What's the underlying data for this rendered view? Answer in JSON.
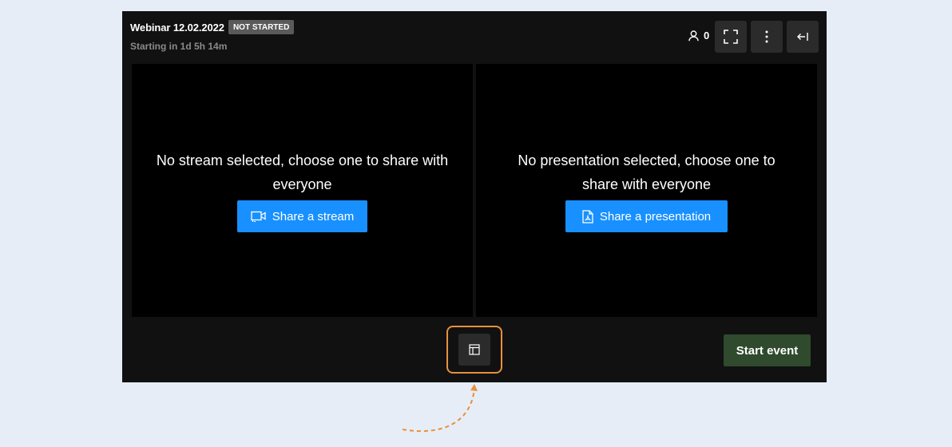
{
  "header": {
    "title": "Webinar 12.02.2022",
    "status_badge": "NOT STARTED",
    "subtitle": "Starting in 1d 5h 14m",
    "participant_count": "0",
    "fullscreen_icon": "fullscreen-icon",
    "menu_icon": "more-vertical-icon",
    "collapse_icon": "arrow-left-bar-icon"
  },
  "panels": {
    "stream": {
      "message": "No stream selected, choose one to share with everyone",
      "button_label": "Share a stream",
      "icon": "video-camera-icon"
    },
    "presentation": {
      "message": "No presentation selected, choose one to share with everyone",
      "button_label": "Share a presentation",
      "icon": "pdf-file-icon"
    }
  },
  "footer": {
    "layout_icon": "layout-icon",
    "start_label": "Start event"
  },
  "colors": {
    "background": "#e6edf6",
    "app_bg": "#111111",
    "panel_bg": "#000000",
    "primary": "#1890ff",
    "start_button": "#2f4a2d",
    "highlight": "#e8913a"
  }
}
